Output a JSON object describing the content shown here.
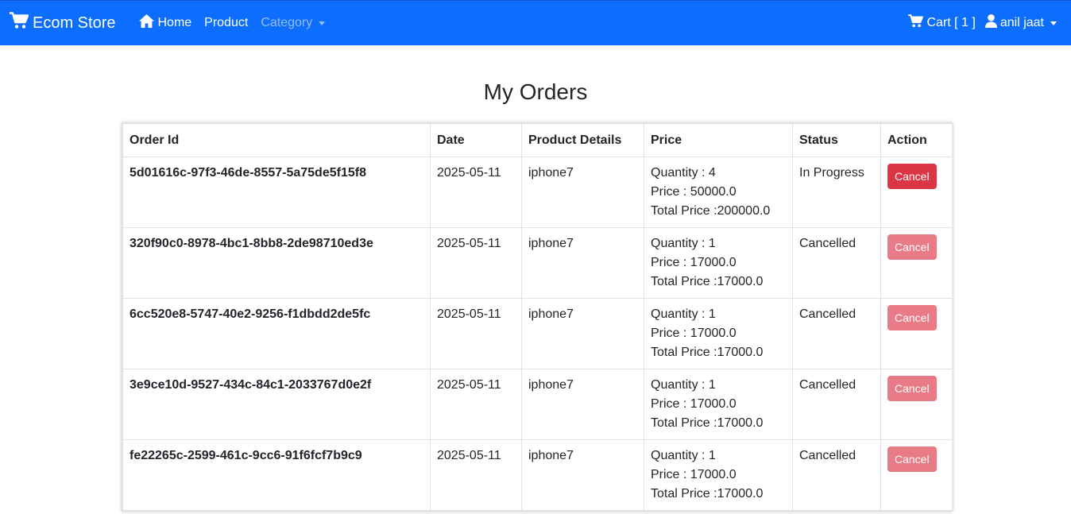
{
  "navbar": {
    "brand": "Ecom Store",
    "home": "Home",
    "product": "Product",
    "category": "Category",
    "cart": "Cart [ 1 ]",
    "user": "anil jaat",
    "colors": {
      "bg": "#0d6efd",
      "text": "#ffffff"
    }
  },
  "page": {
    "title": "My Orders"
  },
  "table": {
    "headers": [
      "Order Id",
      "Date",
      "Product Details",
      "Price",
      "Status",
      "Action"
    ],
    "rows": [
      {
        "order_id": "5d01616c-97f3-46de-8557-5a75de5f15f8",
        "date": "2025-05-11",
        "product": "iphone7",
        "quantity": "Quantity : 4",
        "price": "Price : 50000.0",
        "total": "Total Price :200000.0",
        "status": "In Progress",
        "action": "Cancel"
      },
      {
        "order_id": "320f90c0-8978-4bc1-8bb8-2de98710ed3e",
        "date": "2025-05-11",
        "product": "iphone7",
        "quantity": "Quantity : 1",
        "price": "Price : 17000.0",
        "total": "Total Price :17000.0",
        "status": "Cancelled",
        "action": "Cancel"
      },
      {
        "order_id": "6cc520e8-5747-40e2-9256-f1dbdd2de5fc",
        "date": "2025-05-11",
        "product": "iphone7",
        "quantity": "Quantity : 1",
        "price": "Price : 17000.0",
        "total": "Total Price :17000.0",
        "status": "Cancelled",
        "action": "Cancel"
      },
      {
        "order_id": "3e9ce10d-9527-434c-84c1-2033767d0e2f",
        "date": "2025-05-11",
        "product": "iphone7",
        "quantity": "Quantity : 1",
        "price": "Price : 17000.0",
        "total": "Total Price :17000.0",
        "status": "Cancelled",
        "action": "Cancel"
      },
      {
        "order_id": "fe22265c-2599-461c-9cc6-91f6fcf7b9c9",
        "date": "2025-05-11",
        "product": "iphone7",
        "quantity": "Quantity : 1",
        "price": "Price : 17000.0",
        "total": "Total Price :17000.0",
        "status": "Cancelled",
        "action": "Cancel"
      }
    ]
  },
  "colors": {
    "cancel_button": "#dc3545"
  }
}
